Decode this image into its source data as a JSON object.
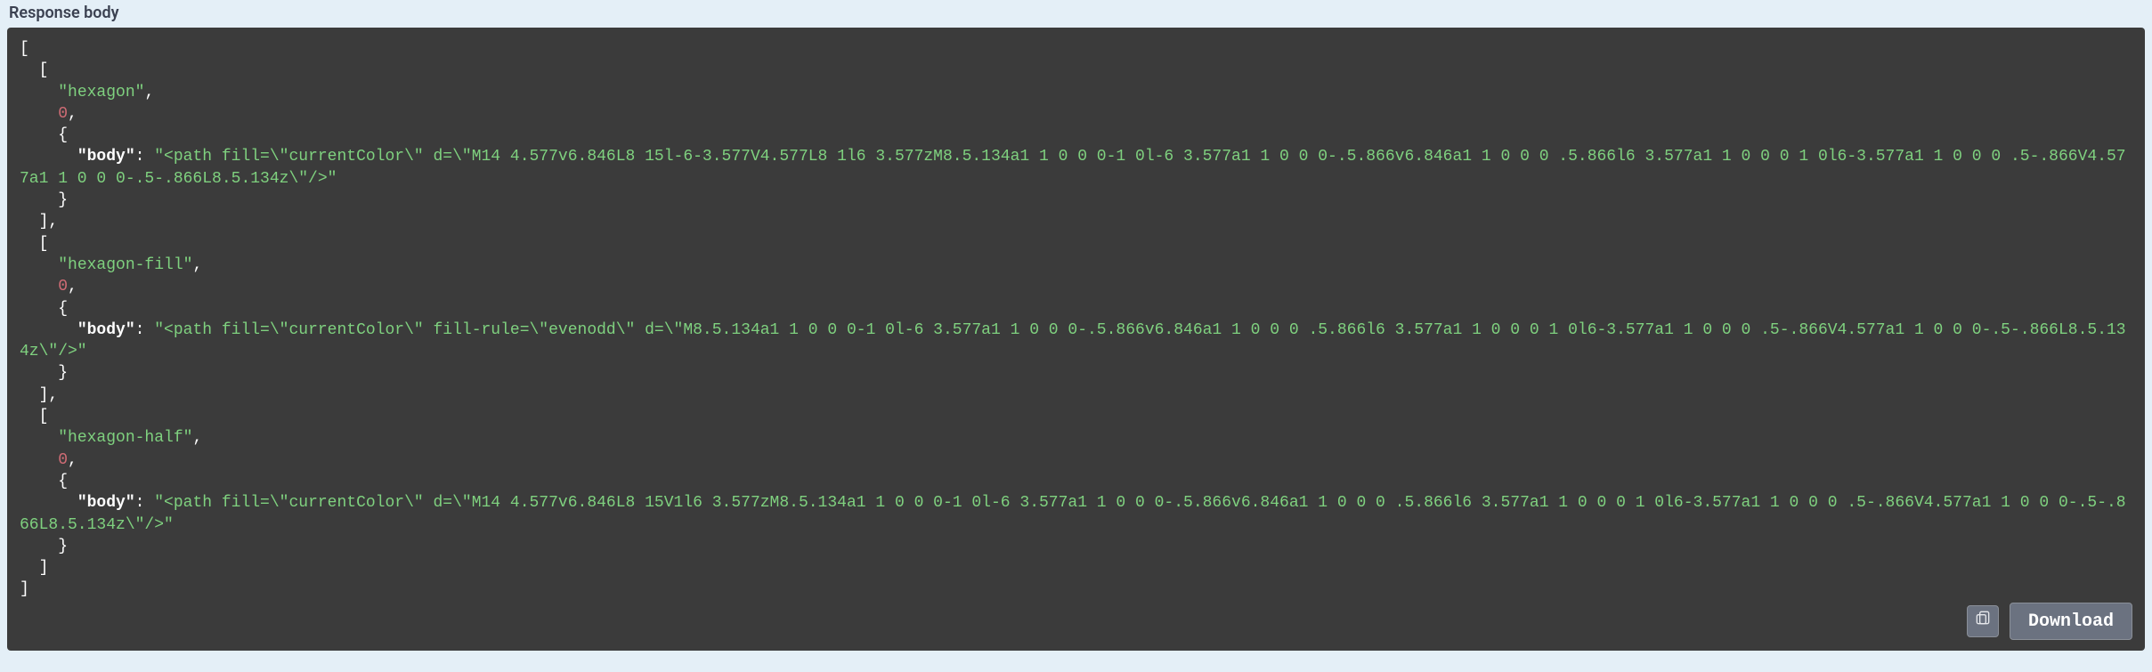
{
  "section_label": "Response body",
  "controls": {
    "download_label": "Download"
  },
  "response_body": [
    [
      "hexagon",
      0,
      {
        "body": "<path fill=\"currentColor\" d=\"M14 4.577v6.846L8 15l-6-3.577V4.577L8 1l6 3.577zM8.5.134a1 1 0 0 0-1 0l-6 3.577a1 1 0 0 0-.5.866v6.846a1 1 0 0 0 .5.866l6 3.577a1 1 0 0 0 1 0l6-3.577a1 1 0 0 0 .5-.866V4.577a1 1 0 0 0-.5-.866L8.5.134z\"/>"
      }
    ],
    [
      "hexagon-fill",
      0,
      {
        "body": "<path fill=\"currentColor\" fill-rule=\"evenodd\" d=\"M8.5.134a1 1 0 0 0-1 0l-6 3.577a1 1 0 0 0-.5.866v6.846a1 1 0 0 0 .5.866l6 3.577a1 1 0 0 0 1 0l6-3.577a1 1 0 0 0 .5-.866V4.577a1 1 0 0 0-.5-.866L8.5.134z\"/>"
      }
    ],
    [
      "hexagon-half",
      0,
      {
        "body": "<path fill=\"currentColor\" d=\"M14 4.577v6.846L8 15V1l6 3.577zM8.5.134a1 1 0 0 0-1 0l-6 3.577a1 1 0 0 0-.5.866v6.846a1 1 0 0 0 .5.866l6 3.577a1 1 0 0 0 1 0l6-3.577a1 1 0 0 0 .5-.866V4.577a1 1 0 0 0-.5-.866L8.5.134z\"/>"
      }
    ]
  ]
}
